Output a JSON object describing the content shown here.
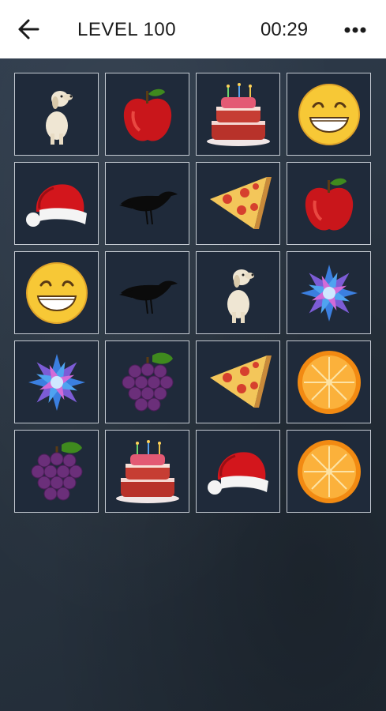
{
  "header": {
    "title": "LEVEL 100",
    "timer": "00:29"
  },
  "icons": {
    "back": "arrow-left-icon",
    "more": "more-dots-icon"
  },
  "colors": {
    "header_bg": "#ffffff",
    "board_bg": "#2a3645",
    "card_bg": "#1f2a3a",
    "card_border": "#c4cad2"
  },
  "grid": {
    "rows": 5,
    "cols": 4,
    "cards": [
      "dog",
      "apple",
      "cake",
      "smiley",
      "santa-hat",
      "crow",
      "pizza",
      "apple",
      "smiley",
      "crow",
      "dog",
      "blue-flower",
      "blue-flower",
      "grapes",
      "pizza",
      "orange",
      "grapes",
      "cake",
      "santa-hat",
      "orange"
    ]
  }
}
